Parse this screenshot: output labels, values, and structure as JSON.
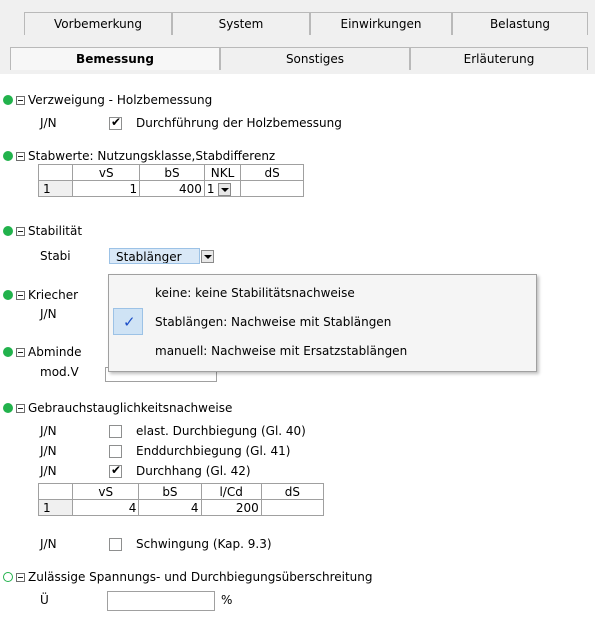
{
  "tabs_row1": [
    "Vorbemerkung",
    "System",
    "Einwirkungen",
    "Belastung"
  ],
  "tabs_row2": [
    "Bemessung",
    "Sonstiges",
    "Erläuterung"
  ],
  "sections": {
    "verzweigung": {
      "title": "Verzweigung - Holzbemessung",
      "row_label": "J/N",
      "checkbox_label": "Durchführung der Holzbemessung",
      "checked": true
    },
    "stabwerte": {
      "title": "Stabwerte: Nutzungsklasse,Stabdifferenz",
      "headers": [
        "vS",
        "bS",
        "NKL",
        "dS"
      ],
      "row": {
        "index": "1",
        "vS": "1",
        "bS": "400",
        "NKL": "1",
        "dS": ""
      }
    },
    "stabilitaet": {
      "title": "Stabilität",
      "row_label": "Stabi",
      "value": "Stablänger"
    },
    "kriechen": {
      "title": "Kriecher",
      "row_label": "J/N"
    },
    "abminderung": {
      "title": "Abminde",
      "row_label": "mod.V"
    },
    "gebrauch": {
      "title": "Gebrauchstauglichkeitsnachweise",
      "rows": [
        {
          "label": "J/N",
          "text": "elast. Durchbiegung (Gl. 40)",
          "checked": false
        },
        {
          "label": "J/N",
          "text": "Enddurchbiegung (Gl. 41)",
          "checked": false
        },
        {
          "label": "J/N",
          "text": "Durchhang (Gl. 42)",
          "checked": true
        }
      ],
      "headers": [
        "vS",
        "bS",
        "l/Cd",
        "dS"
      ],
      "table_row": {
        "index": "1",
        "vS": "4",
        "bS": "4",
        "lcd": "200",
        "dS": ""
      },
      "schwingung": {
        "label": "J/N",
        "text": "Schwingung (Kap. 9.3)",
        "checked": false
      }
    },
    "zulaessig": {
      "title": "Zulässige Spannungs- und Durchbiegungsüberschreitung",
      "row_label": "Ü",
      "unit": "%"
    }
  },
  "dropdown": {
    "options": [
      "keine: keine Stabilitätsnachweise",
      "Stablängen: Nachweise mit Stablängen",
      "manuell: Nachweise mit Ersatzstablängen"
    ],
    "selected_index": 1
  },
  "colors": {
    "active_dot": "#22b24c",
    "highlight": "#cfe3f5"
  },
  "icons": {
    "check": "✔",
    "selected": "✓"
  }
}
